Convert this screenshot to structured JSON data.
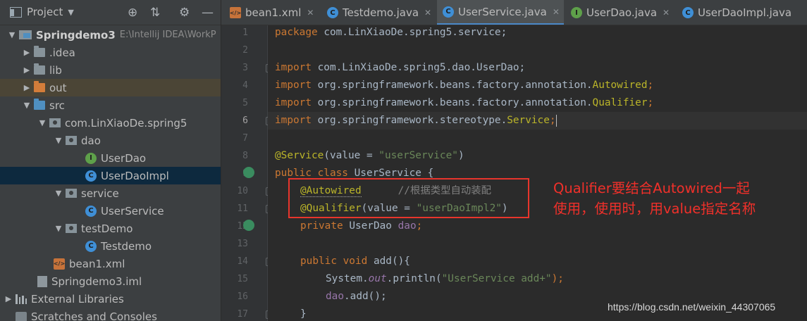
{
  "project_panel": {
    "title": "Project",
    "tree": [
      {
        "label": "Springdemo3",
        "path": "E:\\Intellij IDEA\\WorkP"
      },
      {
        "label": ".idea"
      },
      {
        "label": "lib"
      },
      {
        "label": "out"
      },
      {
        "label": "src"
      },
      {
        "label": "com.LinXiaoDe.spring5"
      },
      {
        "label": "dao"
      },
      {
        "label": "UserDao"
      },
      {
        "label": "UserDaoImpl"
      },
      {
        "label": "service"
      },
      {
        "label": "UserService"
      },
      {
        "label": "testDemo"
      },
      {
        "label": "Testdemo"
      },
      {
        "label": "bean1.xml"
      },
      {
        "label": "Springdemo3.iml"
      },
      {
        "label": "External Libraries"
      },
      {
        "label": "Scratches and Consoles"
      }
    ]
  },
  "tabs": [
    {
      "label": "bean1.xml",
      "icon": "xml-file-icon"
    },
    {
      "label": "Testdemo.java",
      "icon": "class-icon"
    },
    {
      "label": "UserService.java",
      "icon": "class-icon",
      "active": true
    },
    {
      "label": "UserDao.java",
      "icon": "interface-icon"
    },
    {
      "label": "UserDaoImpl.java",
      "icon": "class-icon"
    }
  ],
  "editor": {
    "current_line": 6,
    "line_numbers": [
      "1",
      "2",
      "3",
      "4",
      "5",
      "6",
      "7",
      "8",
      "9",
      "10",
      "11",
      "12",
      "13",
      "14",
      "15",
      "16",
      "17"
    ],
    "code": {
      "l1_kw": "package",
      "l1_rest": " com.LinXiaoDe.spring5.service;",
      "l3_kw": "import",
      "l3_rest": " com.LinXiaoDe.spring5.dao.UserDao;",
      "l4_kw": "import",
      "l4_rest": " org.springframework.beans.factory.annotation.",
      "l4_an": "Autowired",
      "l4_end": ";",
      "l5_kw": "import",
      "l5_rest": " org.springframework.beans.factory.annotation.",
      "l5_an": "Qualifier",
      "l5_end": ";",
      "l6_kw": "import",
      "l6_rest": " org.springframework.stereotype.",
      "l6_an": "Service",
      "l6_end": ";",
      "l8_an": "@Service",
      "l8_mid": "(value = ",
      "l8_st": "\"userService\"",
      "l8_end": ")",
      "l9_kw": "public class",
      "l9_rest": " UserService {",
      "l10_an": "@Autowired",
      "l10_cm": "      //根据类型自动装配",
      "l11_an": "@Qualifier",
      "l11_mid": "(value = ",
      "l11_st": "\"userDaoImpl2\"",
      "l11_end": ")",
      "l12_kw": "private",
      "l12_rest": " UserDao ",
      "l12_fd": "dao",
      "l12_end": ";",
      "l14_kw": "public void",
      "l14_rest": " add(){",
      "l15_a": "System.",
      "l15_it": "out",
      "l15_b": ".println(",
      "l15_st": "\"UserService add+\"",
      "l15_end": ");",
      "l16_fd": "dao",
      "l16_rest": ".add();",
      "l17": "}"
    }
  },
  "annotation": {
    "note": "Qualifier要结合Autowired一起\n使用，使用时，用value指定名称",
    "color": "#f0302a"
  },
  "watermark": "https://blog.csdn.net/weixin_44307065",
  "colors": {
    "keyword": "#cc7832",
    "annotation": "#bbb529",
    "string": "#6a8759",
    "field": "#9876aa",
    "comment": "#808080",
    "selection": "#0d293e",
    "active_tab_underline": "#4a88c7"
  }
}
